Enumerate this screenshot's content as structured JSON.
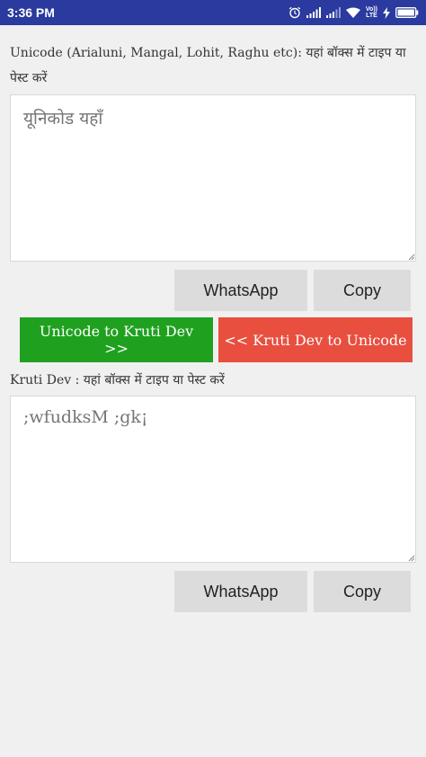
{
  "status_bar": {
    "time": "3:36 PM",
    "lte_top": "Vo))",
    "lte_bottom": "LTE",
    "icons": [
      "alarm-icon",
      "signal-icon",
      "signal-icon",
      "wifi-icon",
      "volte-icon",
      "charging-bolt-icon",
      "battery-icon"
    ]
  },
  "unicode_section": {
    "label": "Unicode (Arialuni, Mangal, Lohit, Raghu etc): यहां बॉक्स में टाइप या पेस्ट करें",
    "placeholder": "यूनिकोड यहाँ",
    "whatsapp_label": "WhatsApp",
    "copy_label": "Copy"
  },
  "convert": {
    "to_kruti_label": "Unicode to Kruti Dev >>",
    "to_unicode_label": "<< Kruti Dev to Unicode",
    "to_kruti_color": "#1fa11f",
    "to_unicode_color": "#e84f3f"
  },
  "kruti_section": {
    "label": "Kruti Dev : यहां बॉक्स में टाइप या पेस्ट करें",
    "placeholder": ";wfudksM ;gk¡",
    "whatsapp_label": "WhatsApp",
    "copy_label": "Copy"
  }
}
